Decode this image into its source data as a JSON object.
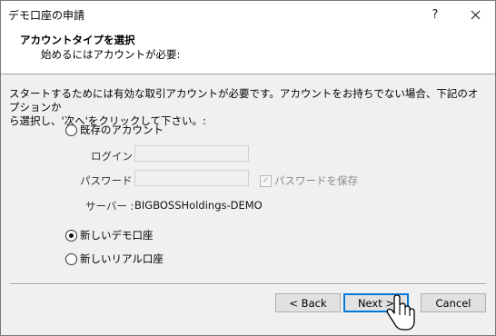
{
  "dialog": {
    "title": "デモ口座の申請",
    "help_glyph": "?",
    "close_glyph": "✕"
  },
  "header": {
    "title": "アカウントタイプを選択",
    "subtitle": "始めるにはアカウントが必要:"
  },
  "description_lines": [
    "スタートするためには有効な取引アカウントが必要です。アカウントをお持ちでない場合、下記のオプションか",
    "ら選択し、'次へ'をクリックして下さい。:"
  ],
  "options": {
    "existing": {
      "label": "既存のアカウント",
      "selected": false
    },
    "new_demo": {
      "label": "新しいデモ口座",
      "selected": true
    },
    "new_real": {
      "label": "新しいリアル口座",
      "selected": false
    }
  },
  "existing_account": {
    "login_label": "ログイン :",
    "login_value": "",
    "password_label": "パスワード :",
    "password_value": "",
    "save_password_label": "パスワードを保存",
    "save_password_checked": true,
    "server_label": "サーバー :",
    "server_value": "BIGBOSSHoldings-DEMO"
  },
  "buttons": {
    "back": "< Back",
    "next": "Next >",
    "cancel": "Cancel"
  }
}
